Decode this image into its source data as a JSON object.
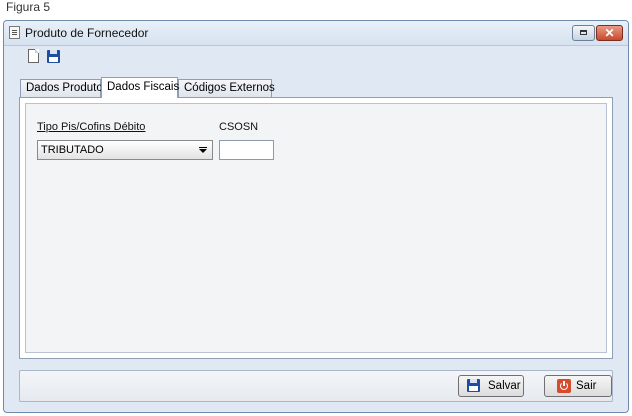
{
  "caption": "Figura 5",
  "window": {
    "title": "Produto de Fornecedor",
    "close_label": "✕"
  },
  "toolbar": {
    "icons": [
      "new-document-icon",
      "save-icon"
    ]
  },
  "tabs": [
    {
      "label": "Dados Produto",
      "active": false
    },
    {
      "label": "Dados Fiscais",
      "active": true
    },
    {
      "label": "Códigos Externos",
      "active": false
    }
  ],
  "form": {
    "pis_cofins_label": "Tipo Pis/Cofins Débito",
    "pis_cofins_value": "TRIBUTADO",
    "csosn_label": "CSOSN",
    "csosn_value": ""
  },
  "buttons": {
    "save_label": "Salvar",
    "exit_label": "Sair"
  },
  "colors": {
    "accent": "#1e4ea0",
    "close_button": "#c74a2b",
    "window_frame": "#dfe8f3"
  }
}
